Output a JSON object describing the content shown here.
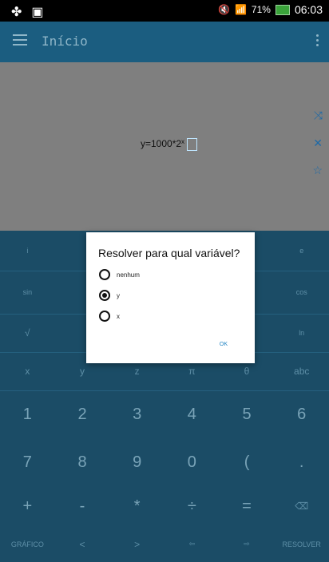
{
  "status_bar": {
    "time": "06:03",
    "battery": "71%"
  },
  "app_bar": {
    "title": "Início"
  },
  "display": {
    "expression_base": "y=1000*2",
    "expression_exp": "x"
  },
  "keypad": {
    "row1": [
      "i",
      "",
      "",
      "",
      "",
      "e"
    ],
    "row2": [
      "sin",
      "",
      "",
      "",
      "",
      "cos"
    ],
    "row3": [
      "√",
      "",
      "",
      "",
      "",
      "ln"
    ],
    "row4": [
      "x",
      "y",
      "z",
      "π",
      "θ",
      "abc"
    ],
    "row5": [
      "1",
      "2",
      "3",
      "4",
      "5",
      "6"
    ],
    "row6": [
      "7",
      "8",
      "9",
      "0",
      "(",
      "."
    ],
    "row7": [
      "+",
      "-",
      "*",
      "÷",
      "=",
      "⌫"
    ],
    "row8": [
      "GRÁFICO",
      "<",
      ">",
      "⇦",
      "⇨",
      "RESOLVER"
    ]
  },
  "dialog": {
    "title": "Resolver para qual variável?",
    "options": [
      "nenhum",
      "y",
      "x"
    ],
    "selected_option": "y",
    "ok_label": "OK"
  }
}
